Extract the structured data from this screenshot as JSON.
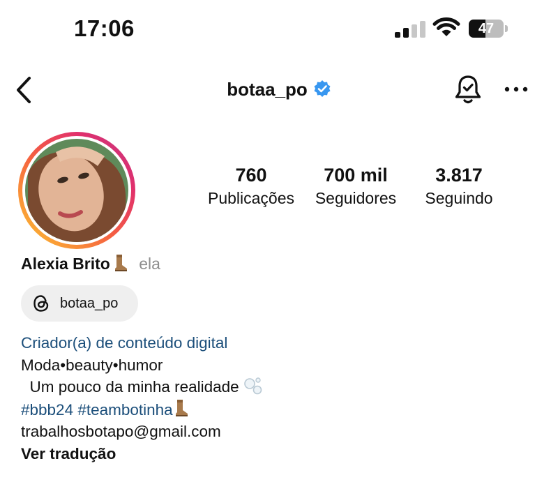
{
  "status_bar": {
    "time": "17:06",
    "battery_level": "47",
    "battery_fraction": 0.47
  },
  "header": {
    "username": "botaa_po",
    "icons": [
      "back-chevron-icon",
      "verified-badge-icon",
      "notification-bell-icon",
      "more-options-icon"
    ]
  },
  "stats": {
    "posts_count": "760",
    "posts_label": "Publicações",
    "followers_count": "700 mil",
    "followers_label": "Seguidores",
    "following_count": "3.817",
    "following_label": "Seguindo"
  },
  "profile": {
    "name": "Alexia Brito",
    "pronouns": "ela",
    "threads_handle": "botaa_po",
    "category": "Criador(a) de conteúdo digital",
    "bio_line_1": "Moda•beauty•humor",
    "bio_line_2": "Um pouco da minha realidade",
    "hashtags": "#bbb24 #teambotinha",
    "email": "trabalhosbotapo@gmail.com",
    "translate_label": "Ver tradução"
  },
  "colors": {
    "link_blue": "#1b4e7a",
    "verified_blue": "#3897f0",
    "pill_background": "#efefef",
    "muted_text": "#8e8e8e"
  }
}
